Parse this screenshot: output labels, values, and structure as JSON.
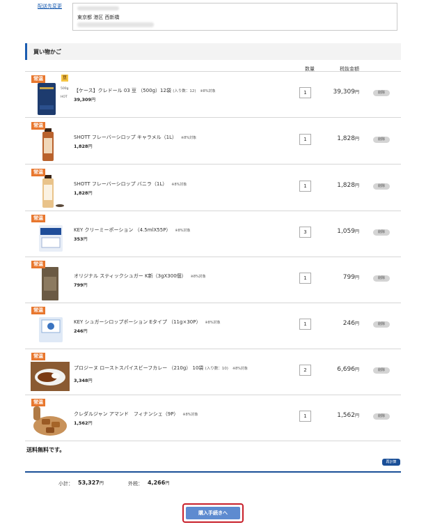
{
  "address": {
    "change_link": "配送先変更",
    "line": "東京都 港区 西新橋"
  },
  "cart": {
    "title": "買い物かご",
    "col_qty": "数量",
    "col_price": "税抜金額",
    "yen": "円",
    "delete_label": "削除",
    "items": [
      {
        "badge": "常温",
        "name": "【ケース】クレドール 03 豆 （500g）12袋",
        "note": "(入り数：12)",
        "tax": "※8%対象",
        "unit_price": "39,309",
        "qty": "1",
        "price": "39,309",
        "tag_bean": "豆",
        "tag_500": "500g",
        "tag_hot": "HOT"
      },
      {
        "badge": "常温",
        "name": "SHOTT フレーバーシロップ キャラメル（1L）",
        "note": "",
        "tax": "※8%対象",
        "unit_price": "1,828",
        "qty": "1",
        "price": "1,828"
      },
      {
        "badge": "常温",
        "name": "SHOTT フレーバーシロップ バニラ（1L）",
        "note": "",
        "tax": "※8%対象",
        "unit_price": "1,828",
        "qty": "1",
        "price": "1,828"
      },
      {
        "badge": "常温",
        "name": "KEY クリーミーポーション （4.5mlX55P）",
        "note": "",
        "tax": "※8%対象",
        "unit_price": "353",
        "qty": "3",
        "price": "1,059"
      },
      {
        "badge": "常温",
        "name": "オリジナル スティックシュガー K新（3gX300個）",
        "note": "",
        "tax": "※8%対象",
        "unit_price": "799",
        "qty": "1",
        "price": "799"
      },
      {
        "badge": "常温",
        "name": "KEY シュガーシロップポーション Eタイプ （11g×30P）",
        "note": "",
        "tax": "※8%対象",
        "unit_price": "246",
        "qty": "1",
        "price": "246"
      },
      {
        "badge": "常温",
        "name": "プロジーヌ ローストスパイスビーフカレー （210g） 10袋",
        "note": "(入り数：10)",
        "tax": "※8%対象",
        "unit_price": "3,348",
        "qty": "2",
        "price": "6,696"
      },
      {
        "badge": "常温",
        "name": "クレダルジャン アマンド　フィナンシェ（9P）",
        "note": "",
        "tax": "※8%対象",
        "unit_price": "1,562",
        "qty": "1",
        "price": "1,562"
      }
    ]
  },
  "summary": {
    "free_shipping": "送料無料です。",
    "recalc_label": "再計算",
    "subtotal_label": "小計：",
    "subtotal_value": "53,327",
    "tax_label": "外税：",
    "tax_value": "4,266",
    "yen": "円"
  },
  "proceed_label": "購入手続きへ",
  "colors": {
    "accent": "#1a5cb0",
    "badge": "#e8772e",
    "proceed": "#5e8bd0",
    "highlight": "#c81f2a"
  }
}
